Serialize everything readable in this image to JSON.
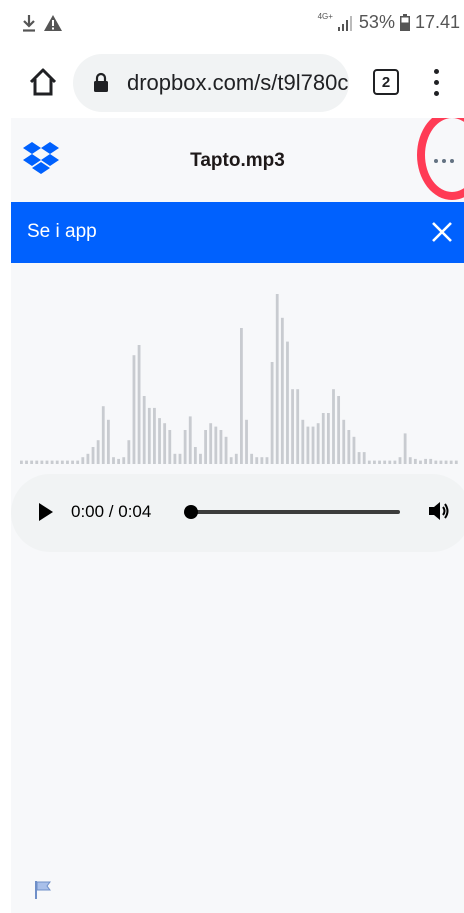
{
  "status_bar": {
    "network": "4G+",
    "battery": "53%",
    "time": "17.41"
  },
  "browser": {
    "url": "dropbox.com/s/t9l780c",
    "tab_count": "2"
  },
  "header": {
    "title": "Tapto.mp3"
  },
  "banner": {
    "label": "Se i app"
  },
  "player": {
    "time": "0:00 / 0:04",
    "progress": 0
  },
  "waveform": {
    "levels": [
      0.02,
      0.02,
      0.02,
      0.02,
      0.02,
      0.02,
      0.02,
      0.02,
      0.02,
      0.02,
      0.02,
      0.02,
      0.04,
      0.06,
      0.1,
      0.14,
      0.34,
      0.26,
      0.04,
      0.03,
      0.04,
      0.14,
      0.64,
      0.7,
      0.4,
      0.33,
      0.33,
      0.27,
      0.24,
      0.2,
      0.06,
      0.06,
      0.2,
      0.28,
      0.1,
      0.06,
      0.2,
      0.24,
      0.22,
      0.2,
      0.16,
      0.04,
      0.06,
      0.8,
      0.26,
      0.06,
      0.04,
      0.04,
      0.04,
      0.6,
      1.0,
      0.86,
      0.72,
      0.44,
      0.44,
      0.26,
      0.22,
      0.22,
      0.24,
      0.3,
      0.3,
      0.44,
      0.4,
      0.26,
      0.2,
      0.16,
      0.07,
      0.07,
      0.02,
      0.02,
      0.02,
      0.02,
      0.02,
      0.02,
      0.04,
      0.18,
      0.04,
      0.03,
      0.02,
      0.03,
      0.03,
      0.02,
      0.02,
      0.02,
      0.02,
      0.02
    ],
    "accent": "#c8cbd0"
  },
  "colors": {
    "banner": "#0061fe",
    "highlight": "#ff3b55",
    "logo": "#0061fe"
  },
  "icons": {
    "download": "download-icon",
    "warning": "warning-icon",
    "signal": "signal-icon",
    "battery": "battery-icon",
    "home": "home-icon",
    "lock": "lock-icon",
    "menu": "vertical-dots-icon",
    "logo": "dropbox-logo",
    "more": "more-horizontal-icon",
    "close": "close-icon",
    "play": "play-icon",
    "volume": "volume-icon",
    "flag": "flag-icon"
  }
}
